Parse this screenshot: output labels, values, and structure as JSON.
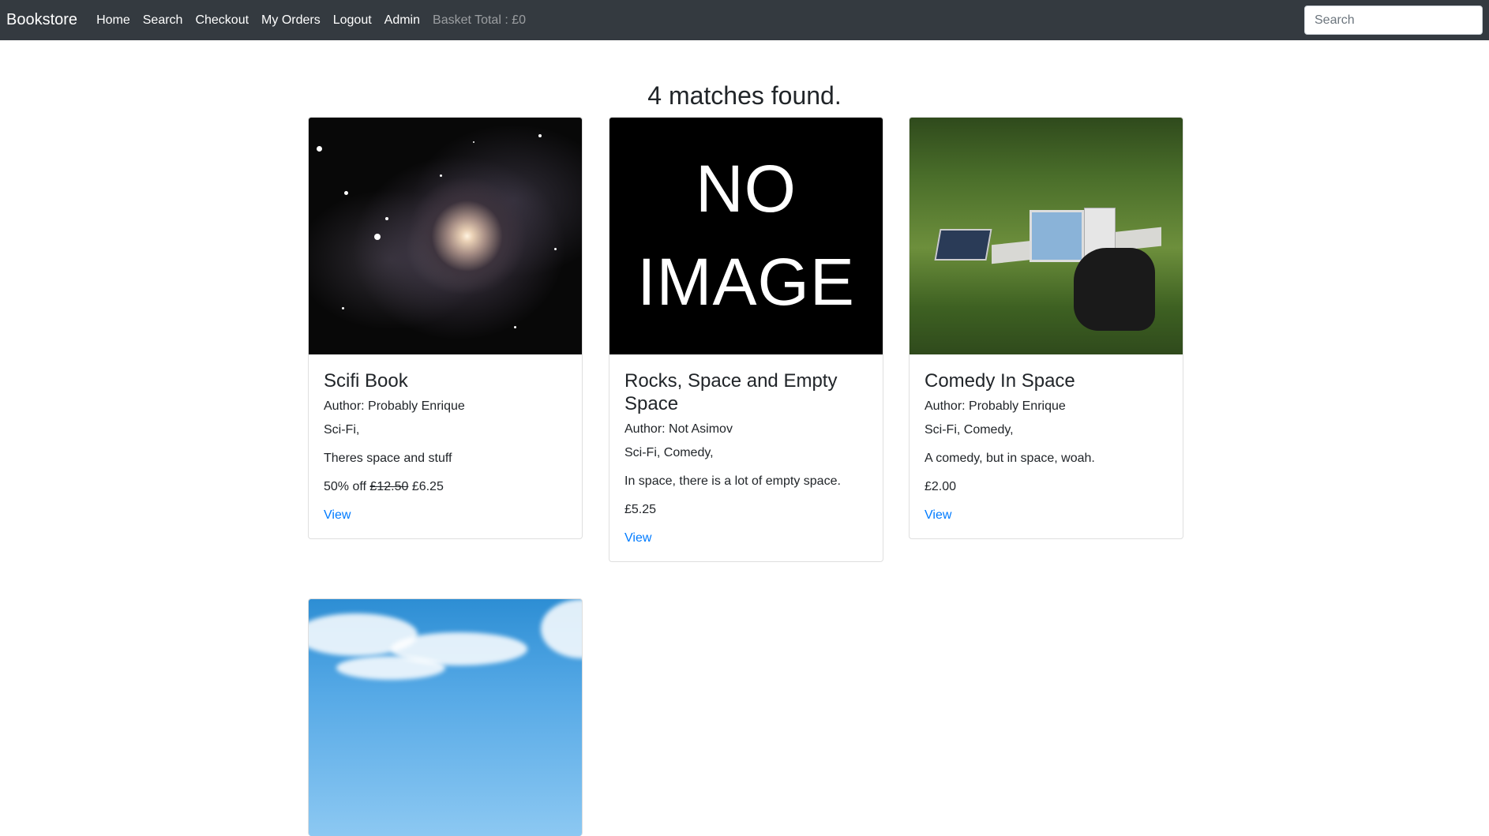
{
  "nav": {
    "brand": "Bookstore",
    "links": [
      "Home",
      "Search",
      "Checkout",
      "My Orders",
      "Logout",
      "Admin"
    ],
    "basket": "Basket Total : £0",
    "search_placeholder": "Search"
  },
  "results": {
    "heading": "4 matches found."
  },
  "books": [
    {
      "title": "Scifi Book",
      "author": "Author: Probably Enrique",
      "genres": "Sci-Fi,",
      "description": "Theres space and stuff",
      "discount": "50% off",
      "old_price": "£12.50",
      "price": "£6.25",
      "view": "View",
      "image": "galaxy-image"
    },
    {
      "title": "Rocks, Space and Empty Space",
      "author": "Author: Not Asimov",
      "genres": "Sci-Fi, Comedy,",
      "description": "In space, there is a lot of empty space.",
      "price": "£5.25",
      "view": "View",
      "image_text_1": "NO",
      "image_text_2": "IMAGE"
    },
    {
      "title": "Comedy In Space",
      "author": "Author: Probably Enrique",
      "genres": "Sci-Fi, Comedy,",
      "description": "A comedy, but in space, woah.",
      "price": "£2.00",
      "view": "View",
      "image": "office-in-grass-image"
    },
    {
      "image": "sky-clouds-image"
    }
  ]
}
